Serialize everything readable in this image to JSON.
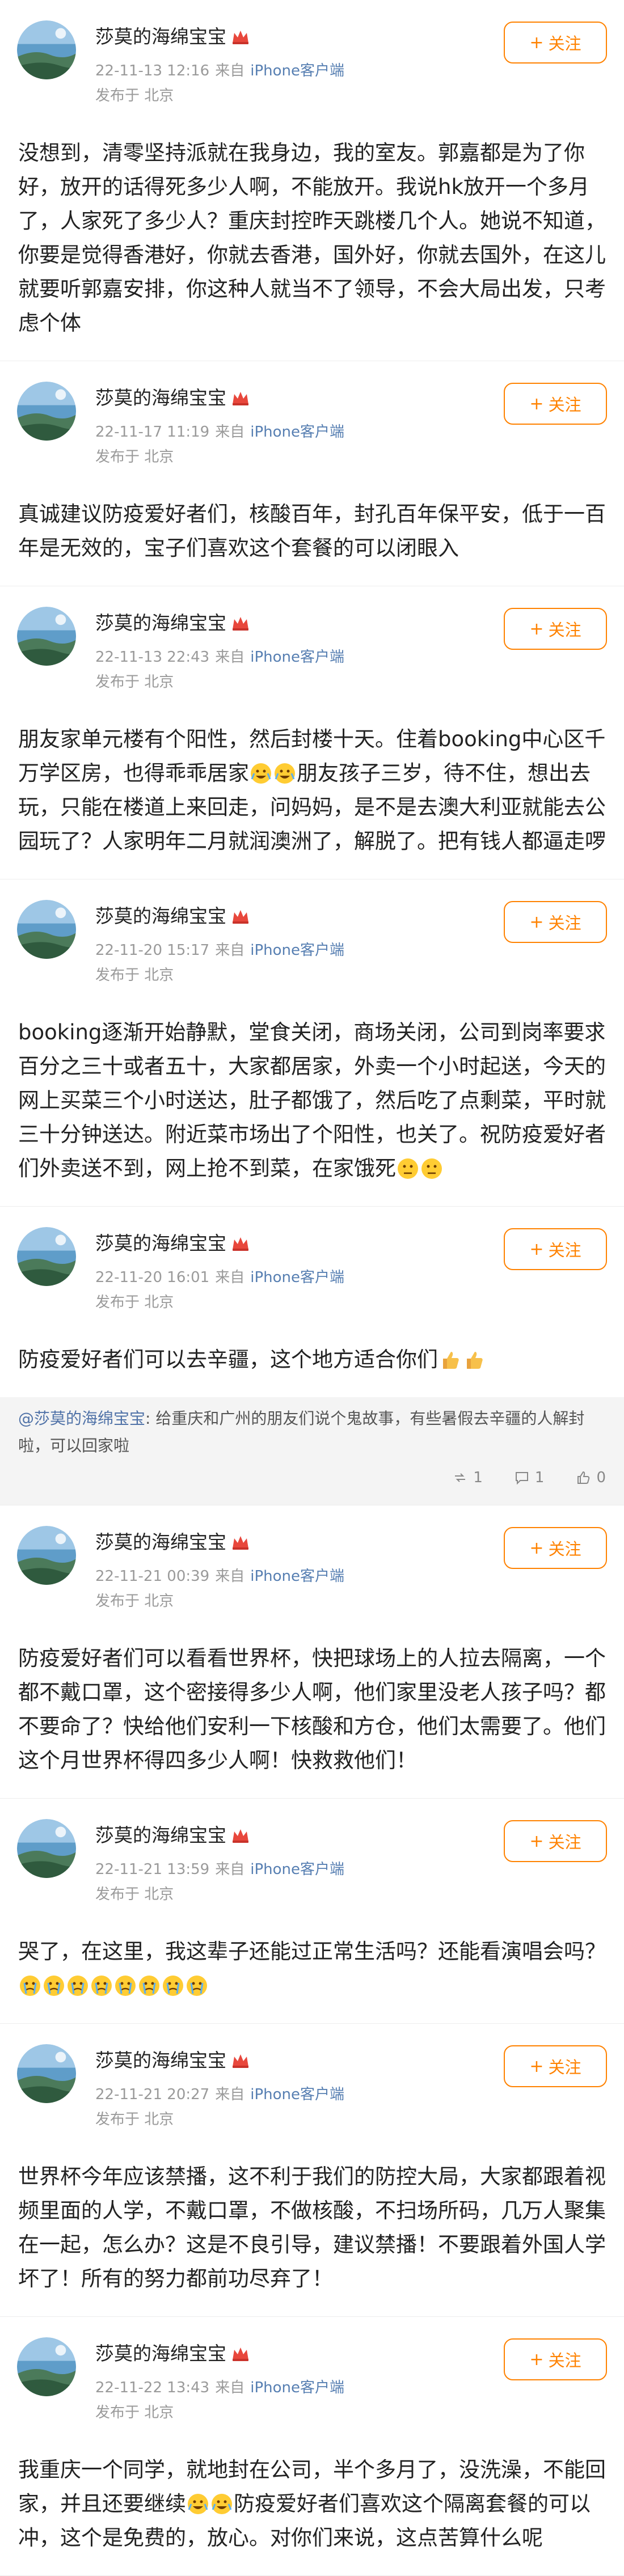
{
  "colors": {
    "accent": "#ff8200",
    "link": "#5173a8",
    "source": "#577fb2",
    "meta": "#9a9a9a"
  },
  "icons": {
    "crown": "crown-icon",
    "plus": "plus-icon",
    "repost": "repost-icon",
    "comment": "comment-icon",
    "like": "like-icon"
  },
  "author": {
    "name": "莎莫的海绵宝宝",
    "avatar": "avatar-seascape"
  },
  "follow_label": "关注",
  "source_prefix": "来自",
  "location": "发布于 北京",
  "posts": [
    {
      "date": "22-11-13 12:16",
      "client": "iPhone客户端",
      "text": "没想到，清零坚持派就在我身边，我的室友。郭嘉都是为了你好，放开的话得死多少人啊，不能放开。我说hk放开一个多月了，人家死了多少人？重庆封控昨天跳楼几个人。她说不知道，你要是觉得香港好，你就去香港，国外好，你就去国外，在这儿就要听郭嘉安排，你这种人就当不了领导，不会大局出发，只考虑个体"
    },
    {
      "date": "22-11-17 11:19",
      "client": "iPhone客户端",
      "text": "真诚建议防疫爱好者们，核酸百年，封孔百年保平安，低于一百年是无效的，宝子们喜欢这个套餐的可以闭眼入"
    },
    {
      "date": "22-11-13 22:43",
      "client": "iPhone客户端",
      "text": "朋友家单元楼有个阳性，然后封楼十天。住着booking中心区千万学区房，也得乖乖居家",
      "text_b": "朋友孩子三岁，待不住，想出去玩，只能在楼道上来回走，问妈妈，是不是去澳大利亚就能去公园玩了？人家明年二月就润澳洲了，解脱了。把有钱人都逼走啰"
    },
    {
      "date": "22-11-20 15:17",
      "client": "iPhone客户端",
      "text": "booking逐渐开始静默，堂食关闭，商场关闭，公司到岗率要求百分之三十或者五十，大家都居家，外卖一个小时起送，今天的网上买菜三个小时送达，肚子都饿了，然后吃了点剩菜，平时就三十分钟送达。附近菜市场出了个阳性，也关了。祝防疫爱好者们外卖送不到，网上抢不到菜，在家饿死"
    },
    {
      "date": "22-11-20 16:01",
      "client": "iPhone客户端",
      "text": "防疫爱好者们可以去辛疆，这个地方适合你们",
      "repost": {
        "mention": "@莎莫的海绵宝宝",
        "text": ": 给重庆和广州的朋友们说个鬼故事，有些暑假去辛疆的人解封啦，可以回家啦",
        "reposts": "1",
        "comments": "1",
        "likes": "0"
      }
    },
    {
      "date": "22-11-21 00:39",
      "client": "iPhone客户端",
      "text": "防疫爱好者们可以看看世界杯，快把球场上的人拉去隔离，一个都不戴口罩，这个密接得多少人啊，他们家里没老人孩子吗？都不要命了？快给他们安利一下核酸和方仓，他们太需要了。他们这个月世界杯得四多少人啊！快救救他们！"
    },
    {
      "date": "22-11-21 13:59",
      "client": "iPhone客户端",
      "text": "哭了，在这里，我这辈子还能过正常生活吗？还能看演唱会吗？"
    },
    {
      "date": "22-11-21 20:27",
      "client": "iPhone客户端",
      "text": "世界杯今年应该禁播，这不利于我们的防控大局，大家都跟着视频里面的人学，不戴口罩，不做核酸，不扫场所码，几万人聚集在一起，怎么办？这是不良引导，建议禁播！不要跟着外国人学坏了！所有的努力都前功尽弃了！"
    },
    {
      "date": "22-11-22 13:43",
      "client": "iPhone客户端",
      "text": "我重庆一个同学，就地封在公司，半个多月了，没洗澡，不能回家，并且还要继续",
      "text_b": "防疫爱好者们喜欢这个隔离套餐的可以冲，这个是免费的，放心。对你们来说，这点苦算什么呢"
    }
  ]
}
